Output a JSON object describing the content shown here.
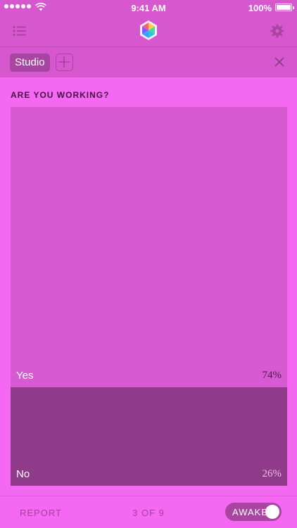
{
  "status_bar": {
    "time": "9:41 AM",
    "battery": "100%"
  },
  "header": {
    "logo_icon": "hexagon-cube-logo",
    "menu_icon": "list-icon",
    "settings_icon": "gear-icon"
  },
  "tags": {
    "items": [
      {
        "label": "Studio"
      }
    ],
    "add_icon": "plus-icon",
    "close_icon": "close-icon"
  },
  "question": "ARE YOU WORKING?",
  "chart_data": {
    "type": "bar",
    "orientation": "stacked-vertical",
    "categories": [
      "Yes",
      "No"
    ],
    "values": [
      74,
      26
    ],
    "value_labels": [
      "74%",
      "26%"
    ],
    "colors": [
      "#d85ad3",
      "#8f3a8a"
    ]
  },
  "footer": {
    "report_label": "REPORT",
    "page": "3 OF 9",
    "awake_label": "AWAKE",
    "awake_on": true
  },
  "colors": {
    "background": "#f569f2",
    "header": "#d757cf",
    "accent": "#a845a0"
  }
}
